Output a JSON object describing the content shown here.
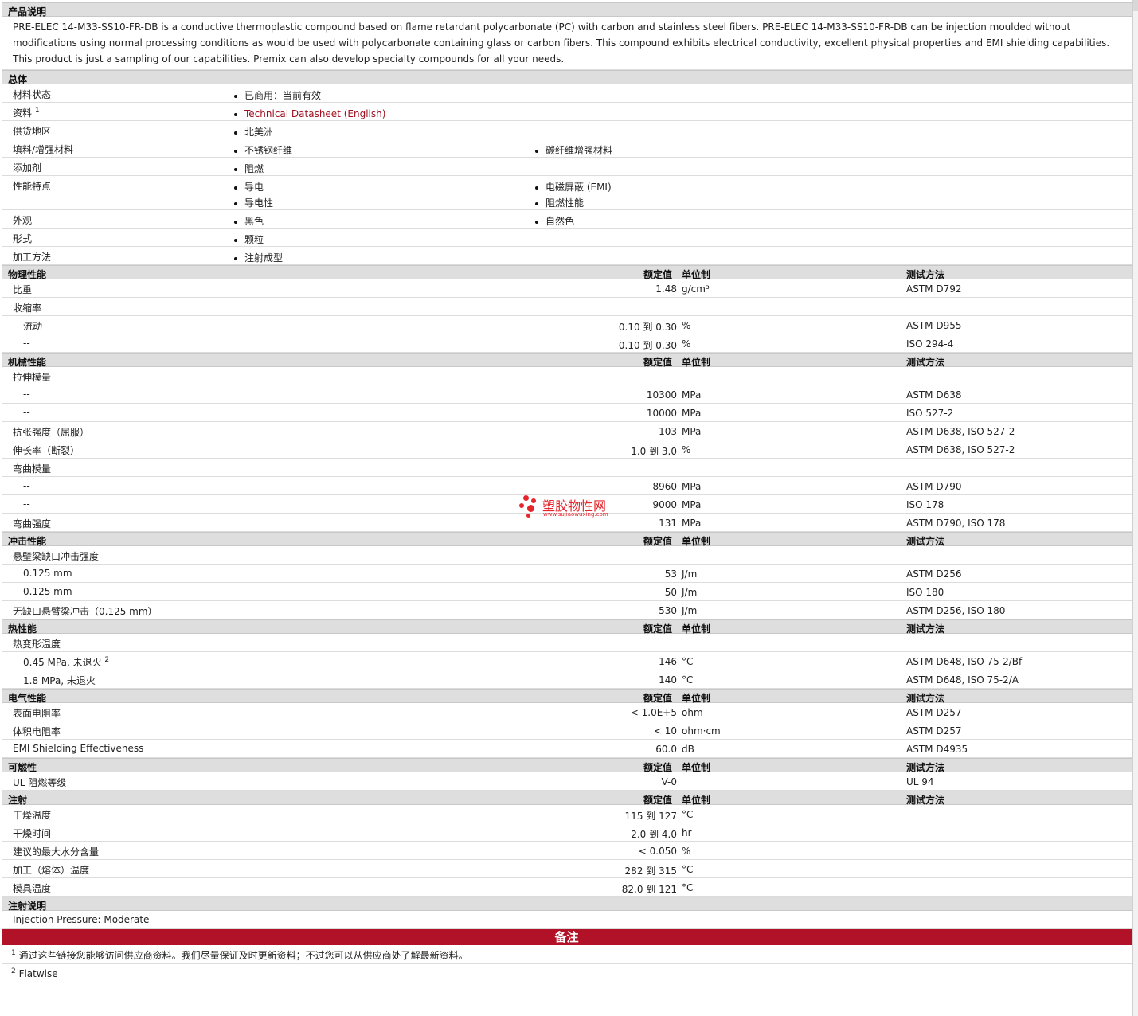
{
  "product_description": {
    "heading": "产品说明",
    "text": "PRE-ELEC 14-M33-SS10-FR-DB is a conductive thermoplastic compound based on flame retardant polycarbonate (PC) with carbon and stainless steel fibers. PRE-ELEC 14-M33-SS10-FR-DB can be injection moulded without modifications using normal processing conditions as would be used with polycarbonate containing glass or carbon fibers. This compound exhibits electrical conductivity, excellent physical properties and EMI shielding capabilities. This product is just a sampling of our capabilities. Premix can also develop specialty compounds for all your needs."
  },
  "general": {
    "heading": "总体",
    "rows": [
      {
        "label": "材料状态",
        "col1": [
          "已商用：当前有效"
        ],
        "col2": []
      },
      {
        "label": "资料",
        "sup": "1",
        "col1": [
          "Technical Datasheet (English)"
        ],
        "col2": []
      },
      {
        "label": "供货地区",
        "col1": [
          "北美洲"
        ],
        "col2": []
      },
      {
        "label": "填料/增强材料",
        "col1": [
          "不锈钢纤维"
        ],
        "col2": [
          "碳纤维增强材料"
        ]
      },
      {
        "label": "添加剂",
        "col1": [
          "阻燃"
        ],
        "col2": []
      },
      {
        "label": "性能特点",
        "col1": [
          "导电",
          "导电性"
        ],
        "col2": [
          "电磁屏蔽 (EMI)",
          "阻燃性能"
        ]
      },
      {
        "label": "外观",
        "col1": [
          "黑色"
        ],
        "col2": [
          "自然色"
        ]
      },
      {
        "label": "形式",
        "col1": [
          "颗粒"
        ],
        "col2": []
      },
      {
        "label": "加工方法",
        "col1": [
          "注射成型"
        ],
        "col2": []
      }
    ]
  },
  "col_headers": {
    "value": "额定值",
    "unit": "单位制",
    "method": "测试方法"
  },
  "sections": [
    {
      "title": "物理性能",
      "rows": [
        {
          "label": "比重",
          "value": "1.48",
          "unit": "g/cm³",
          "method": "ASTM D792"
        },
        {
          "label": "收缩率",
          "value": "",
          "unit": "",
          "method": ""
        },
        {
          "label": "流动",
          "sub": true,
          "value": "0.10 到  0.30",
          "unit": "%",
          "method": "ASTM D955"
        },
        {
          "label": "--",
          "sub": true,
          "value": "0.10 到  0.30",
          "unit": "%",
          "method": "ISO 294-4"
        }
      ]
    },
    {
      "title": "机械性能",
      "rows": [
        {
          "label": "拉伸模量",
          "value": "",
          "unit": "",
          "method": ""
        },
        {
          "label": "--",
          "sub": true,
          "value": "10300",
          "unit": "MPa",
          "method": "ASTM D638"
        },
        {
          "label": "--",
          "sub": true,
          "value": "10000",
          "unit": "MPa",
          "method": "ISO 527-2"
        },
        {
          "label": "抗张强度（屈服）",
          "value": "103",
          "unit": "MPa",
          "method": "ASTM D638, ISO 527-2"
        },
        {
          "label": "伸长率（断裂）",
          "value": "1.0 到  3.0",
          "unit": "%",
          "method": "ASTM D638, ISO 527-2"
        },
        {
          "label": "弯曲模量",
          "value": "",
          "unit": "",
          "method": ""
        },
        {
          "label": "--",
          "sub": true,
          "value": "8960",
          "unit": "MPa",
          "method": "ASTM D790"
        },
        {
          "label": "--",
          "sub": true,
          "value": "9000",
          "unit": "MPa",
          "method": "ISO 178"
        },
        {
          "label": "弯曲强度",
          "value": "131",
          "unit": "MPa",
          "method": "ASTM D790, ISO 178"
        }
      ]
    },
    {
      "title": "冲击性能",
      "rows": [
        {
          "label": "悬壁梁缺口冲击强度",
          "value": "",
          "unit": "",
          "method": ""
        },
        {
          "label": "0.125 mm",
          "sub": true,
          "value": "53",
          "unit": "J/m",
          "method": "ASTM D256"
        },
        {
          "label": "0.125 mm",
          "sub": true,
          "value": "50",
          "unit": "J/m",
          "method": "ISO 180"
        },
        {
          "label": "无缺口悬臂梁冲击（0.125 mm）",
          "value": "530",
          "unit": "J/m",
          "method": "ASTM D256, ISO 180"
        }
      ]
    },
    {
      "title": "热性能",
      "rows": [
        {
          "label": "热变形温度",
          "value": "",
          "unit": "",
          "method": ""
        },
        {
          "label": "0.45 MPa, 未退火",
          "sup": "2",
          "sub": true,
          "value": "146",
          "unit": "°C",
          "method": "ASTM D648, ISO 75-2/Bf"
        },
        {
          "label": "1.8 MPa, 未退火",
          "sub": true,
          "value": "140",
          "unit": "°C",
          "method": "ASTM D648, ISO 75-2/A"
        }
      ]
    },
    {
      "title": "电气性能",
      "rows": [
        {
          "label": "表面电阻率",
          "value": "< 1.0E+5",
          "unit": "ohm",
          "method": "ASTM D257"
        },
        {
          "label": "体积电阻率",
          "value": "< 10",
          "unit": "ohm·cm",
          "method": "ASTM D257"
        },
        {
          "label": "EMI Shielding Effectiveness",
          "value": "60.0",
          "unit": "dB",
          "method": "ASTM D4935"
        }
      ]
    },
    {
      "title": "可燃性",
      "rows": [
        {
          "label": "UL 阻燃等级",
          "value": "V-0",
          "unit": "",
          "method": "UL 94"
        }
      ]
    },
    {
      "title": "注射",
      "rows": [
        {
          "label": "干燥温度",
          "value": "115 到  127",
          "unit": "°C",
          "method": ""
        },
        {
          "label": "干燥时间",
          "value": "2.0 到  4.0",
          "unit": "hr",
          "method": ""
        },
        {
          "label": "建议的最大水分含量",
          "value": "< 0.050",
          "unit": "%",
          "method": ""
        },
        {
          "label": "加工（熔体）温度",
          "value": "282 到  315",
          "unit": "°C",
          "method": ""
        },
        {
          "label": "模具温度",
          "value": "82.0 到  121",
          "unit": "°C",
          "method": ""
        }
      ]
    }
  ],
  "injection_notes": {
    "heading": "注射说明",
    "text": "Injection Pressure: Moderate"
  },
  "remarks": {
    "heading": "备注",
    "notes": [
      {
        "num": "1",
        "text": "通过这些链接您能够访问供应商资料。我们尽量保证及时更新资料；不过您可以从供应商处了解最新资料。"
      },
      {
        "num": "2",
        "text": "Flatwise"
      }
    ]
  },
  "watermark": {
    "name": "塑胶物性网",
    "url": "www.sujiaowuxing.com",
    "color": "#e5242b"
  },
  "colors": {
    "accent_red": "#b11228",
    "header_gray": "#dedede"
  }
}
